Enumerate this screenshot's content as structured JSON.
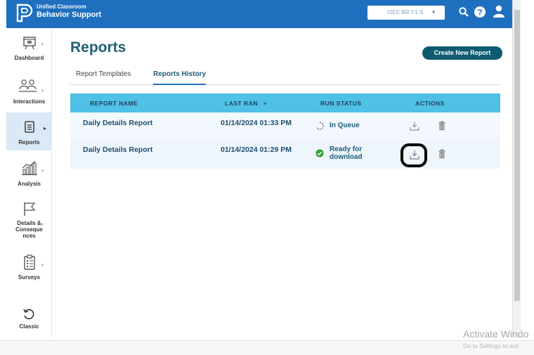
{
  "header": {
    "brand_line1": "Unified Classroom",
    "brand_line2": "Behavior Support",
    "school_select": "ISEE BR Y1-S",
    "bg_color": "#1f6fbf"
  },
  "sidebar": {
    "items": [
      {
        "label": "Dashboard",
        "icon": "presentation-board-icon"
      },
      {
        "label": "Interactions",
        "icon": "people-interaction-icon"
      },
      {
        "label": "Reports",
        "icon": "document-icon"
      },
      {
        "label": "Analysis",
        "icon": "chart-growth-icon"
      },
      {
        "label": "Details & Conseque nces",
        "icon": "flag-icon"
      },
      {
        "label": "Surveys",
        "icon": "clipboard-checklist-icon"
      },
      {
        "label": "Classic",
        "icon": "undo-icon"
      }
    ]
  },
  "main": {
    "title": "Reports",
    "create_button": "Create New Report",
    "tabs": [
      {
        "label": "Report Templates",
        "active": false
      },
      {
        "label": "Reports History",
        "active": true
      }
    ],
    "table": {
      "columns": [
        "REPORT NAME",
        "LAST RAN",
        "RUN STATUS",
        "ACTIONS"
      ],
      "sort_indicator": "▼",
      "rows": [
        {
          "name": "Daily Details Report",
          "last_ran": "01/14/2024 01:33 PM",
          "status": "In Queue",
          "status_icon": "loading-spinner-icon"
        },
        {
          "name": "Daily Details Report",
          "last_ran": "01/14/2024 01:29 PM",
          "status_line1": "Ready for",
          "status_line2": "download",
          "status_icon": "check-circle-icon"
        }
      ]
    }
  },
  "os_watermark": {
    "line1": "Activate Windo",
    "line2": "Go to Settings to acti"
  },
  "colors": {
    "accent": "#1f6fbf",
    "title": "#1f6176",
    "table_header": "#4fc0e6",
    "button": "#0d5b70",
    "success": "#3aa23a"
  }
}
